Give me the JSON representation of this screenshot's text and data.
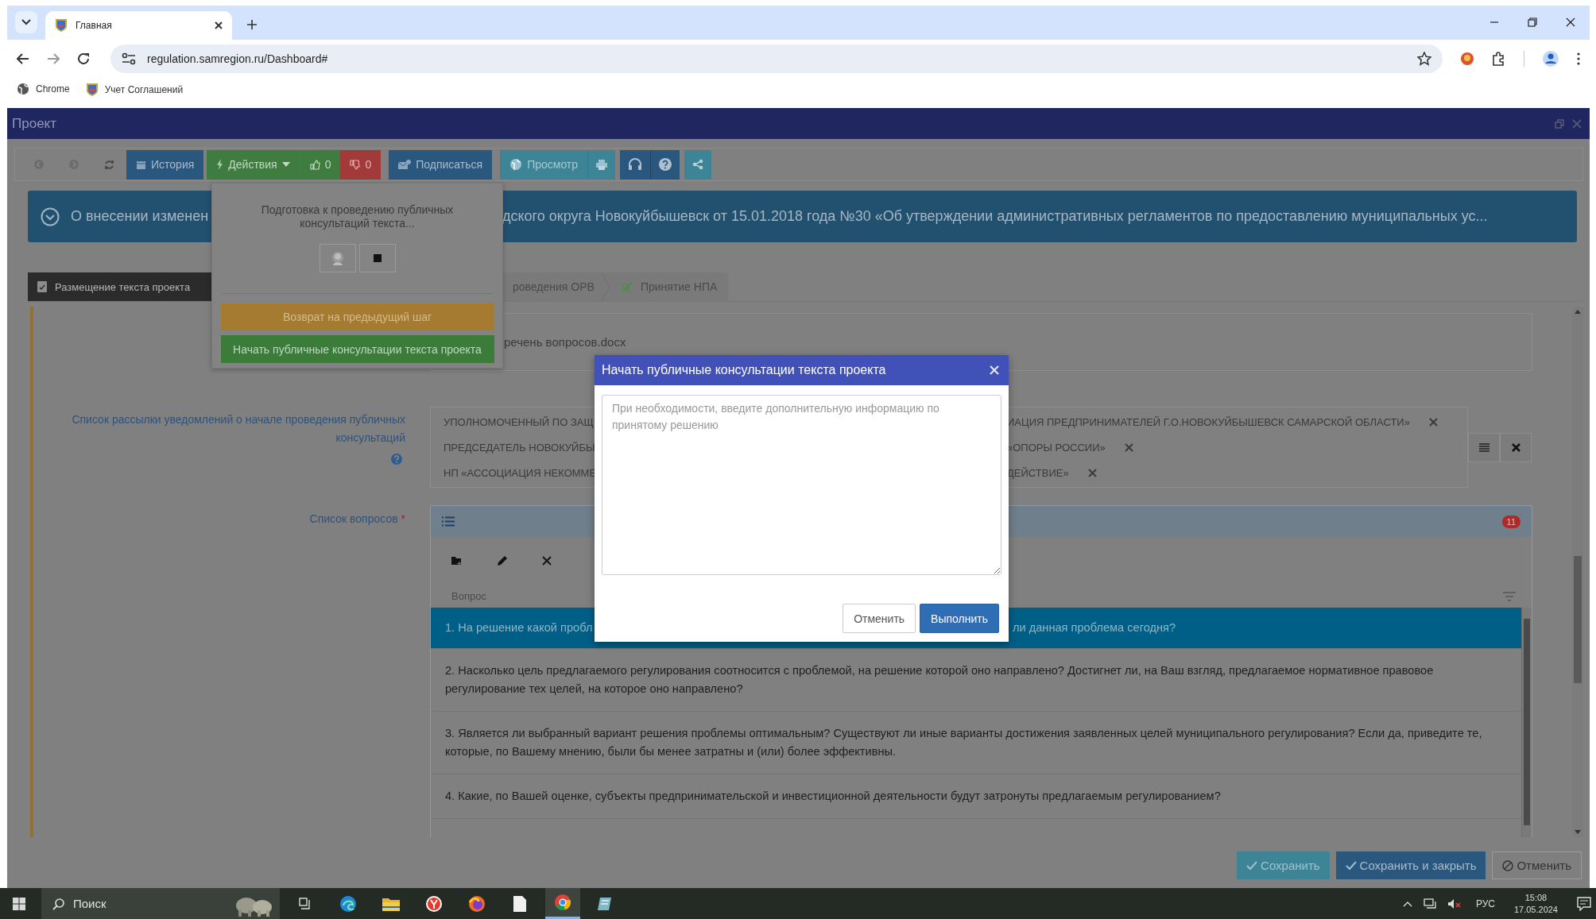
{
  "browser": {
    "tab_title": "Главная",
    "url": "regulation.samregion.ru/Dashboard#",
    "bookmarks": [
      {
        "kind": "globe",
        "label": "Chrome"
      },
      {
        "kind": "emblem",
        "label": "Учет Соглашений"
      }
    ]
  },
  "window": {
    "title": "Проект"
  },
  "toolbar": {
    "buttons": [
      {
        "kind": "back"
      },
      {
        "kind": "forward"
      },
      {
        "kind": "refresh"
      },
      {
        "kind": "history",
        "label": "История"
      },
      {
        "kind": "actions",
        "label": "Действия"
      },
      {
        "kind": "like",
        "label": "0"
      },
      {
        "kind": "dislike",
        "label": "0"
      },
      {
        "kind": "subscribe",
        "label": "Подписаться"
      },
      {
        "kind": "preview",
        "label": "Просмотр"
      },
      {
        "kind": "print"
      },
      {
        "kind": "support"
      },
      {
        "kind": "help"
      },
      {
        "kind": "share"
      }
    ]
  },
  "banner": {
    "parts": [
      "О внесении изменен",
      "дского округа Новокуйбышевск от 15.01.2018 года №30 «Об утверждении административных регламентов по предоставлению муниципальных ус..."
    ]
  },
  "steps": [
    {
      "kind": "document",
      "label": "Размещение текста проекта",
      "selected": true
    },
    {
      "kind": "plain",
      "label": "роведения ОРВ",
      "selected": false
    },
    {
      "kind": "check",
      "label": "Принятие НПА",
      "selected": false
    }
  ],
  "file": {
    "name": "речень вопросов.docx"
  },
  "mailing": {
    "label": "Список рассылки уведомлений о начале проведения публичных консультаций",
    "tags": [
      {
        "parts": [
          "УПОЛНОМОЧЕННЫЙ ПО ЗАЩ",
          "ИАЦИЯ ПРЕДПРИНИМАТЕЛЕЙ Г.О.НОВОКУЙБЫШЕВСК САМАРСКОЙ ОБЛАСТИ»"
        ]
      },
      {
        "parts": [
          "ПРЕДСЕДАТЕЛЬ НОВОКУЙБЫ",
          "«ОПОРЫ РОССИИ»"
        ]
      },
      {
        "parts": [
          "НП «АССОЦИАЦИЯ НЕКОММЕ",
          "ДЕЙСТВИЕ»"
        ]
      }
    ]
  },
  "questions": {
    "label": "Список вопросов",
    "required_mark": "*",
    "count": "11",
    "column": "Вопрос",
    "rows": [
      {
        "parts": [
          "1. На решение какой пробл",
          "ли данная проблема сегодня?"
        ],
        "selected": true
      },
      {
        "parts": [
          "2. Насколько цель предлагаемого регулирования соотносится с проблемой, на решение которой оно направлено? Достигнет ли, на Ваш взгляд, предлагаемое нормативное правовое регулирование тех целей, на которое оно направлено?"
        ],
        "selected": false
      },
      {
        "parts": [
          "3. Является ли выбранный вариант решения проблемы оптимальным? Существуют ли иные варианты достижения заявленных целей муниципального регулирования? Если да, приведите те, которые, по Вашему мнению, были бы менее затратны и (или) более эффективны."
        ],
        "selected": false
      },
      {
        "parts": [
          "4. Какие, по Вашей оценке, субъекты предпринимательской и инвестиционной деятельности будут затронуты предлагаемым регулированием?"
        ],
        "selected": false
      }
    ]
  },
  "dropdown": {
    "status": "Подготовка к проведению публичных консультаций текста...",
    "buttons": [
      {
        "kind": "back",
        "label": "Возврат на предыдущий шаг"
      },
      {
        "kind": "start",
        "label": "Начать публичные консультации текста проекта"
      }
    ]
  },
  "modal": {
    "title": "Начать публичные консультации текста проекта",
    "placeholder": "При необходимости, введите дополнительную информацию по принятому решению",
    "buttons": [
      {
        "kind": "cancel",
        "label": "Отменить"
      },
      {
        "kind": "primary",
        "label": "Выполнить"
      }
    ]
  },
  "footer": {
    "buttons": [
      {
        "kind": "save",
        "label": "Сохранить"
      },
      {
        "kind": "save_close",
        "label": "Сохранить и закрыть"
      },
      {
        "kind": "cancel",
        "label": "Отменить"
      }
    ]
  },
  "taskbar": {
    "search_placeholder": "Поиск",
    "apps": [
      {
        "kind": "taskview",
        "active": false
      },
      {
        "kind": "edge",
        "active": false
      },
      {
        "kind": "folder",
        "active": false
      },
      {
        "kind": "yandex",
        "active": false
      },
      {
        "kind": "firefox",
        "active": false
      },
      {
        "kind": "notes",
        "active": false
      },
      {
        "kind": "chrome",
        "active": true
      },
      {
        "kind": "app",
        "active": false
      }
    ],
    "language": "РУС",
    "time": "15:08",
    "date": "17.05.2024"
  }
}
